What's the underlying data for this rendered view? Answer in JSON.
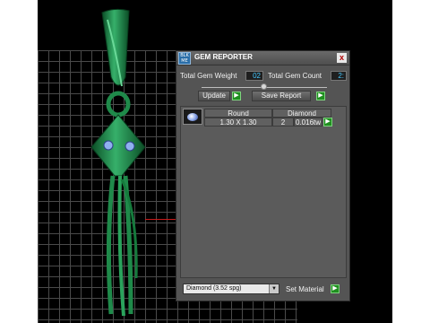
{
  "dialog": {
    "title": "GEM REPORTER",
    "app_icon_text": "BLK ME",
    "close_label": "x",
    "total_weight_label": "Total Gem Weight",
    "total_weight_value": "02",
    "total_count_label": "Total Gem Count",
    "total_count_value": "2:",
    "update_label": "Update",
    "save_report_label": "Save Report",
    "arrow_glyph": "▶"
  },
  "gem_list": {
    "columns": [
      "Round",
      "Diamond"
    ],
    "rows": [
      {
        "size": "1.30 X 1.30",
        "count": "2",
        "weight": "0.016tw"
      }
    ]
  },
  "material": {
    "selected": "Diamond     (3.52 spg)",
    "set_label": "Set Material"
  },
  "colors": {
    "model_green": "#1f8a4a",
    "value_text": "#45c8ff",
    "axis_red": "#c81c1c"
  }
}
